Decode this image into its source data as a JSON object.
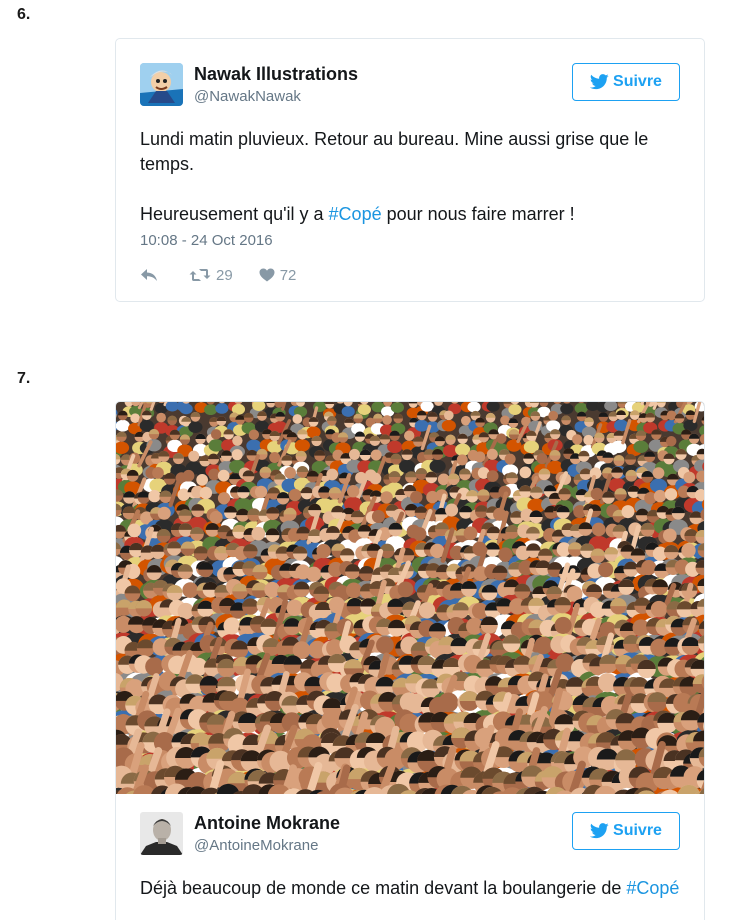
{
  "items": [
    {
      "number": "6.",
      "author": {
        "name": "Nawak Illustrations",
        "handle": "@NawakNawak"
      },
      "follow_label": "Suivre",
      "text_line1": "Lundi matin pluvieux. Retour au bureau. Mine aussi grise que le temps.",
      "text_line2_before": "Heureusement qu'il y a ",
      "text_line2_hashtag": "#Copé",
      "text_line2_after": " pour nous faire marrer !",
      "timestamp": "10:08 - 24 Oct 2016",
      "retweets": "29",
      "likes": "72"
    },
    {
      "number": "7.",
      "photo_icon": "crowd-photo",
      "author": {
        "name": "Antoine Mokrane",
        "handle": "@AntoineMokrane"
      },
      "follow_label": "Suivre",
      "text_before": "Déjà beaucoup de monde ce matin devant la boulangerie de ",
      "text_hashtag": "#Copé"
    }
  ],
  "colors": {
    "accent": "#1da1f2",
    "hashtag": "#1b95e0",
    "muted": "#657786",
    "border": "#e1e8ed"
  },
  "icons": [
    "twitter-bird-icon",
    "reply-icon",
    "retweet-icon",
    "heart-icon"
  ]
}
